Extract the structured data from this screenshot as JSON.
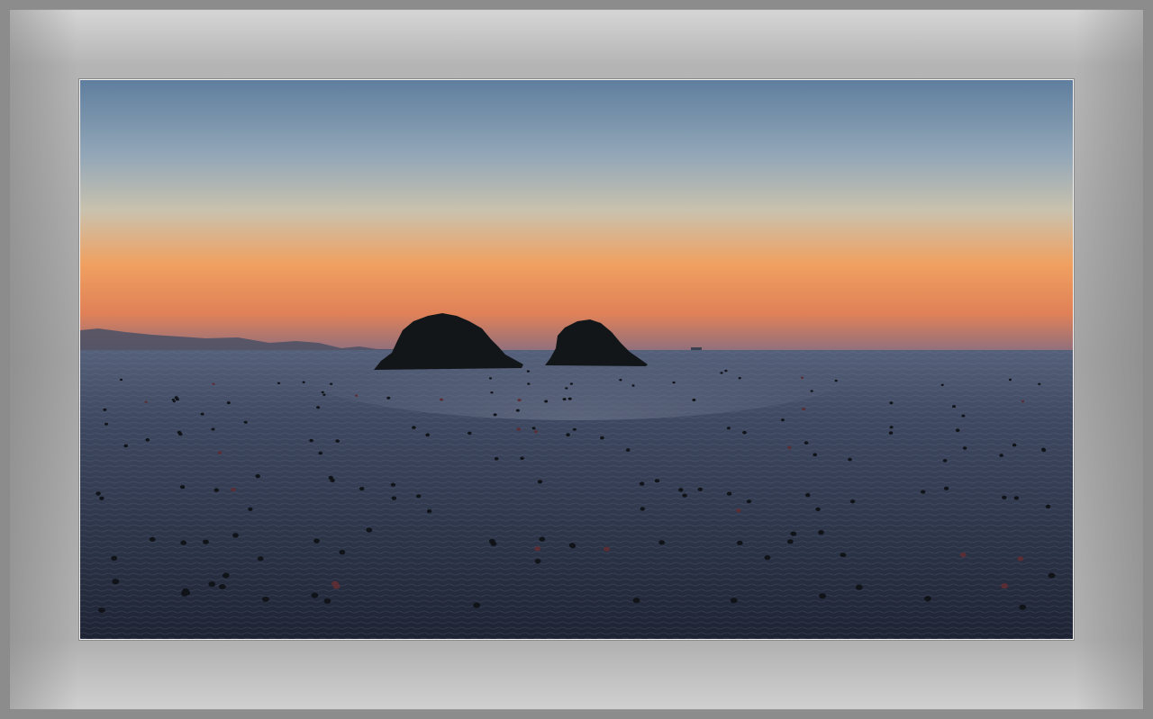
{
  "scene": {
    "subject": "sunset-over-sea-with-two-islands",
    "colors": {
      "sky_top": "#5f7e9e",
      "sky_mid": "#a8b4bc",
      "sky_glow": "#f0a060",
      "sky_horizon": "#c86a5a",
      "sea_dark": "#242c3e",
      "sea_light": "#4a5670",
      "island": "#121619",
      "frame": "#a8a8a8",
      "mat_border": "#f2f2f2"
    },
    "islands": [
      {
        "name": "left-island"
      },
      {
        "name": "right-island"
      }
    ],
    "elements": [
      "distant-mountains",
      "buoy-rows",
      "sea-surface"
    ]
  }
}
